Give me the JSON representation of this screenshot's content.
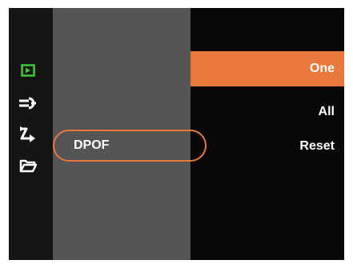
{
  "screen": {
    "accent_color": "#e8783c",
    "active_tab_color": "#3cc83c"
  },
  "sidebar": {
    "icons": [
      {
        "name": "playback-icon",
        "active": true
      },
      {
        "name": "wrench-settings-icon",
        "active": false
      },
      {
        "name": "arrows-transfer-icon",
        "active": false
      },
      {
        "name": "folder-icon",
        "active": false
      }
    ]
  },
  "menu": {
    "item_label": "DPOF",
    "options": [
      "One",
      "All",
      "Reset"
    ],
    "selected_option": "One"
  }
}
